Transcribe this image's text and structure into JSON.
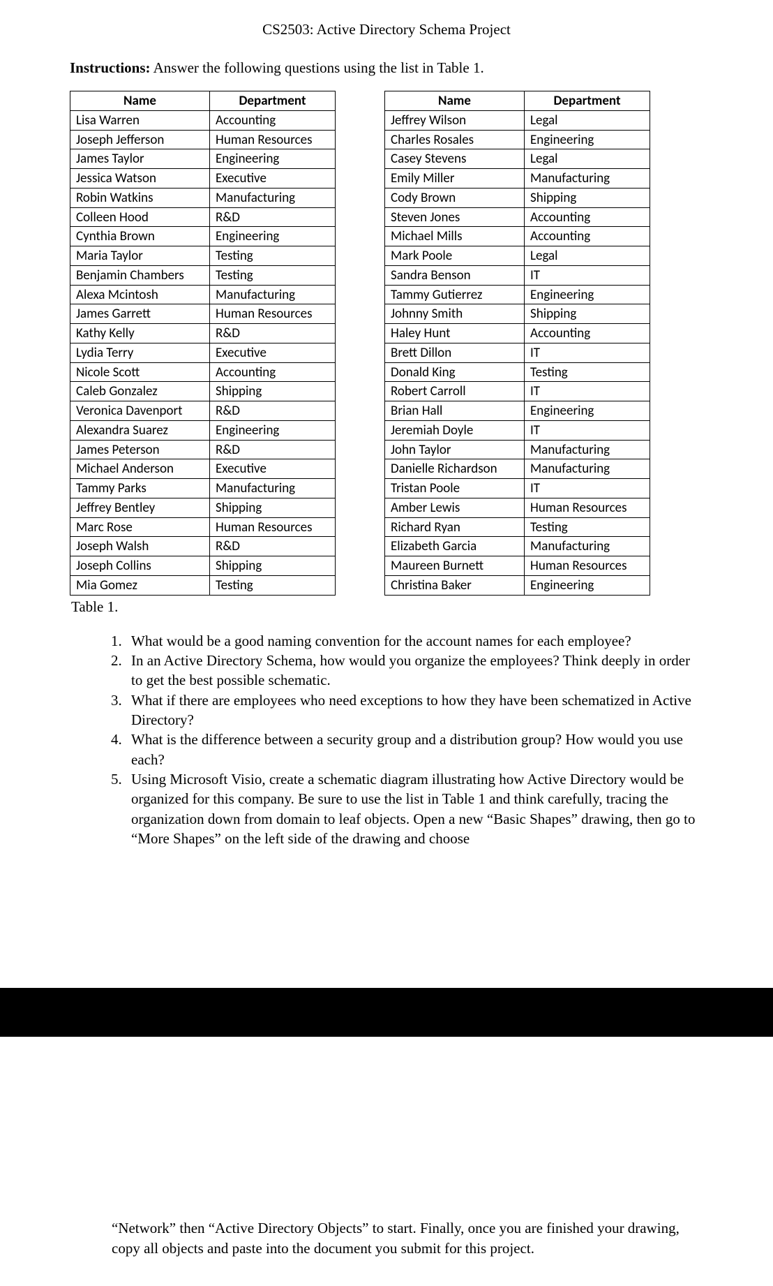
{
  "title": "CS2503: Active Directory Schema Project",
  "instructions_label": "Instructions:",
  "instructions_text": " Answer the following questions using the list in Table 1.",
  "headers": {
    "name": "Name",
    "department": "Department"
  },
  "table_left": [
    {
      "name": "Lisa Warren",
      "dept": "Accounting"
    },
    {
      "name": "Joseph Jefferson",
      "dept": "Human Resources"
    },
    {
      "name": "James Taylor",
      "dept": "Engineering"
    },
    {
      "name": "Jessica Watson",
      "dept": "Executive"
    },
    {
      "name": "Robin Watkins",
      "dept": "Manufacturing"
    },
    {
      "name": "Colleen Hood",
      "dept": "R&D"
    },
    {
      "name": "Cynthia Brown",
      "dept": "Engineering"
    },
    {
      "name": "Maria Taylor",
      "dept": "Testing"
    },
    {
      "name": "Benjamin Chambers",
      "dept": "Testing"
    },
    {
      "name": "Alexa Mcintosh",
      "dept": "Manufacturing"
    },
    {
      "name": "James Garrett",
      "dept": "Human Resources"
    },
    {
      "name": "Kathy Kelly",
      "dept": "R&D"
    },
    {
      "name": "Lydia Terry",
      "dept": "Executive"
    },
    {
      "name": "Nicole Scott",
      "dept": "Accounting"
    },
    {
      "name": "Caleb Gonzalez",
      "dept": "Shipping"
    },
    {
      "name": "Veronica Davenport",
      "dept": "R&D"
    },
    {
      "name": "Alexandra Suarez",
      "dept": "Engineering"
    },
    {
      "name": "James Peterson",
      "dept": "R&D"
    },
    {
      "name": "Michael Anderson",
      "dept": "Executive"
    },
    {
      "name": "Tammy Parks",
      "dept": "Manufacturing"
    },
    {
      "name": "Jeffrey Bentley",
      "dept": "Shipping"
    },
    {
      "name": "Marc Rose",
      "dept": "Human Resources"
    },
    {
      "name": "Joseph Walsh",
      "dept": "R&D"
    },
    {
      "name": "Joseph Collins",
      "dept": "Shipping"
    },
    {
      "name": "Mia Gomez",
      "dept": "Testing"
    }
  ],
  "table_right": [
    {
      "name": "Jeffrey Wilson",
      "dept": "Legal"
    },
    {
      "name": "Charles Rosales",
      "dept": "Engineering"
    },
    {
      "name": "Casey Stevens",
      "dept": "Legal"
    },
    {
      "name": "Emily Miller",
      "dept": "Manufacturing"
    },
    {
      "name": "Cody Brown",
      "dept": "Shipping"
    },
    {
      "name": "Steven Jones",
      "dept": "Accounting"
    },
    {
      "name": "Michael Mills",
      "dept": "Accounting"
    },
    {
      "name": "Mark Poole",
      "dept": "Legal"
    },
    {
      "name": "Sandra Benson",
      "dept": "IT"
    },
    {
      "name": "Tammy Gutierrez",
      "dept": "Engineering"
    },
    {
      "name": "Johnny Smith",
      "dept": "Shipping"
    },
    {
      "name": "Haley Hunt",
      "dept": "Accounting"
    },
    {
      "name": "Brett Dillon",
      "dept": "IT"
    },
    {
      "name": "Donald King",
      "dept": "Testing"
    },
    {
      "name": "Robert Carroll",
      "dept": "IT"
    },
    {
      "name": "Brian Hall",
      "dept": "Engineering"
    },
    {
      "name": "Jeremiah Doyle",
      "dept": "IT"
    },
    {
      "name": "John Taylor",
      "dept": "Manufacturing"
    },
    {
      "name": "Danielle Richardson",
      "dept": "Manufacturing"
    },
    {
      "name": "Tristan Poole",
      "dept": "IT"
    },
    {
      "name": "Amber Lewis",
      "dept": "Human Resources"
    },
    {
      "name": "Richard Ryan",
      "dept": "Testing"
    },
    {
      "name": "Elizabeth Garcia",
      "dept": "Manufacturing"
    },
    {
      "name": "Maureen Burnett",
      "dept": "Human Resources"
    },
    {
      "name": "Christina Baker",
      "dept": "Engineering"
    }
  ],
  "caption": "Table 1.",
  "questions": [
    "What would be a good naming convention for the account names for each employee?",
    "In an Active Directory Schema, how would you organize the employees?  Think deeply in order to get the best possible schematic.",
    "What if there are employees who need exceptions to how they have been schematized in Active Directory?",
    "What is the difference between a security group and a distribution group?  How would you use each?",
    "Using Microsoft Visio, create a schematic diagram illustrating how Active Directory would be organized for this company.  Be sure to use the list in Table 1 and think carefully, tracing the organization down from domain to leaf objects.  Open a new “Basic Shapes” drawing, then go to “More Shapes” on the left side of the drawing and choose"
  ],
  "continuation": "“Network” then “Active Directory Objects” to start.  Finally, once you are finished your drawing, copy all objects and paste into the document you submit for this project."
}
